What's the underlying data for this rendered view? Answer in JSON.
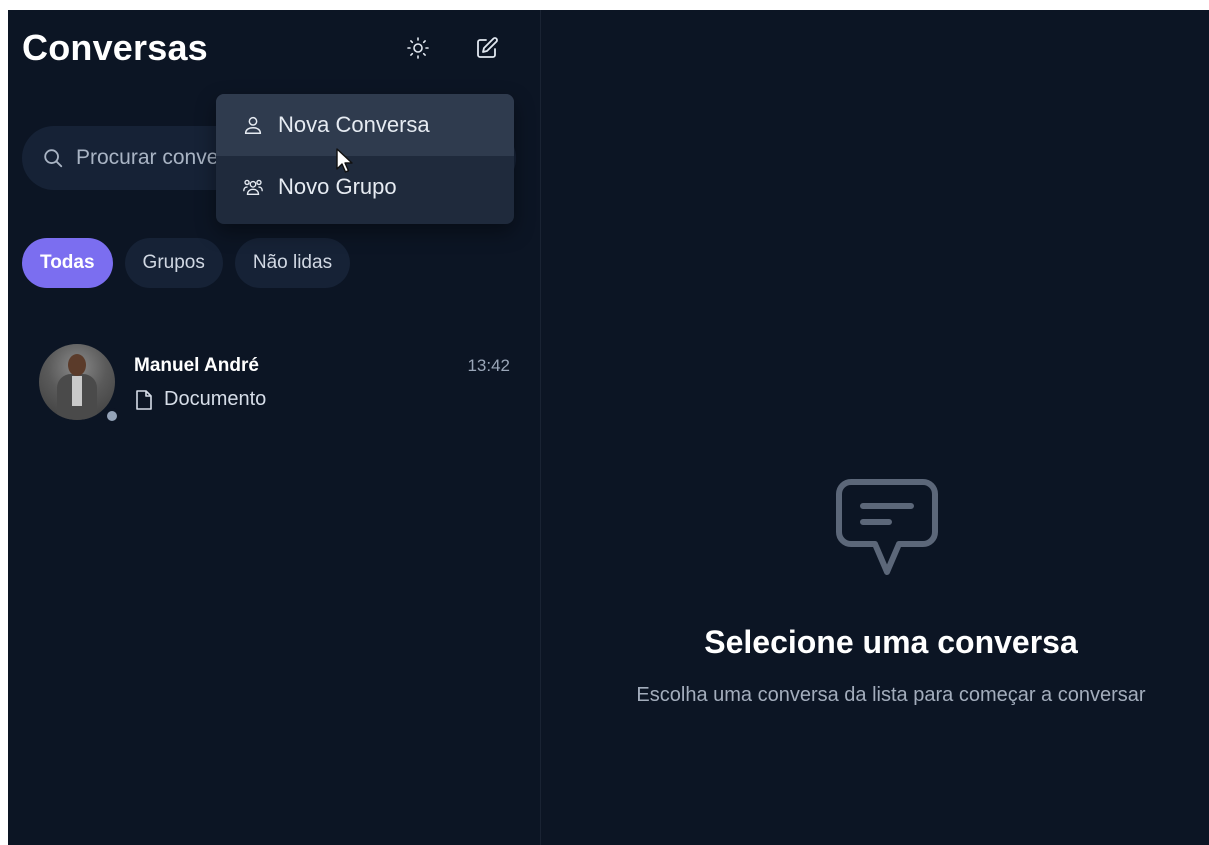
{
  "sidebar": {
    "title": "Conversas",
    "search": {
      "placeholder": "Procurar conversas",
      "value": ""
    },
    "filters": [
      {
        "label": "Todas",
        "active": true
      },
      {
        "label": "Grupos",
        "active": false
      },
      {
        "label": "Não lidas",
        "active": false
      }
    ],
    "conversations": [
      {
        "name": "Manuel André",
        "time": "13:42",
        "preview": "Documento",
        "preview_icon": "file-icon",
        "status": "offline"
      }
    ]
  },
  "menu": {
    "items": [
      {
        "label": "Nova Conversa",
        "icon": "user-icon",
        "hovered": true
      },
      {
        "label": "Novo Grupo",
        "icon": "users-icon",
        "hovered": false
      }
    ]
  },
  "main": {
    "empty_title": "Selecione uma conversa",
    "empty_subtitle": "Escolha uma conversa da lista para começar a conversar",
    "empty_icon": "message-square-icon"
  },
  "colors": {
    "background": "#0c1524",
    "surface": "#162236",
    "accent": "#7b6ef0",
    "menu_bg": "#1f2a3c",
    "menu_hover": "#2f3b4e"
  }
}
